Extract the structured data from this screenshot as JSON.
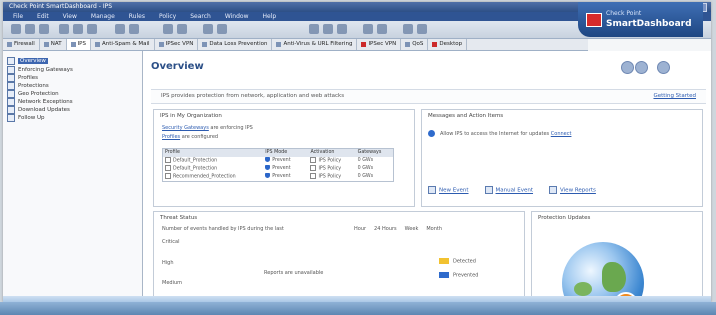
{
  "window": {
    "title": "Check Point SmartDashboard - IPS"
  },
  "menu": [
    "File",
    "Edit",
    "View",
    "Manage",
    "Rules",
    "Policy",
    "Search",
    "Window",
    "Help"
  ],
  "brand": {
    "line1": "Check Point",
    "line2": "SmartDashboard"
  },
  "tabs": [
    {
      "label": "Firewall",
      "icon": "firewall-icon"
    },
    {
      "label": "NAT",
      "icon": "nat-icon"
    },
    {
      "label": "IPS",
      "icon": "ips-icon"
    },
    {
      "label": "Anti-Spam & Mail",
      "icon": "mail-icon"
    },
    {
      "label": "IPSec VPN",
      "icon": "vpn-icon"
    },
    {
      "label": "Data Loss Prevention",
      "icon": "dlp-icon"
    },
    {
      "label": "Anti-Virus & URL Filtering",
      "icon": "antivirus-icon"
    },
    {
      "label": "IPSec VPN",
      "icon": "ipsec-icon"
    },
    {
      "label": "QoS",
      "icon": "qos-icon"
    },
    {
      "label": "Desktop",
      "icon": "desktop-icon"
    }
  ],
  "sidebar": [
    {
      "label": "Overview",
      "selected": true
    },
    {
      "label": "Enforcing Gateways",
      "selected": false
    },
    {
      "label": "Profiles",
      "selected": false
    },
    {
      "label": "Protections",
      "selected": false
    },
    {
      "label": "Geo Protection",
      "selected": false
    },
    {
      "label": "Network Exceptions",
      "selected": false
    },
    {
      "label": "Download Updates",
      "selected": false
    },
    {
      "label": "Follow Up",
      "selected": false
    }
  ],
  "page": {
    "title": "Overview",
    "description": "IPS provides protection from network, application and web attacks",
    "getting_started": "Getting Started"
  },
  "ips_panel": {
    "title": "IPS in My Organization",
    "line1_link": "Security Gateways",
    "line1_rest": "are enforcing IPS",
    "line2_link": "Profiles",
    "line2_rest": "are configured",
    "columns": [
      "Profile",
      "IPS Mode",
      "Activation",
      "Gateways"
    ],
    "rows": [
      {
        "profile": "Default_Protection",
        "mode": "Prevent",
        "activation": "IPS Policy",
        "gateways": "0 GWs"
      },
      {
        "profile": "Default_Protection",
        "mode": "Prevent",
        "activation": "IPS Policy",
        "gateways": "0 GWs"
      },
      {
        "profile": "Recommended_Protection",
        "mode": "Prevent",
        "activation": "IPS Policy",
        "gateways": "0 GWs"
      }
    ]
  },
  "messages_panel": {
    "title": "Messages and Action Items",
    "message": "Allow IPS to access the Internet for updates",
    "message_link": "Connect",
    "actions": [
      "New Event",
      "Manual Event",
      "View Reports"
    ]
  },
  "threat_panel": {
    "title": "Threat Status",
    "subtitle": "Number of events handled by IPS during the last",
    "filters": [
      "Hour",
      "24 Hours",
      "Week",
      "Month"
    ],
    "severities": [
      "Critical",
      "High",
      "Medium"
    ],
    "empty_text": "Reports are unavailable",
    "legend": [
      {
        "label": "Detected",
        "color": "#f2c230"
      },
      {
        "label": "Prevented",
        "color": "#2f6bcc"
      }
    ]
  },
  "update_panel": {
    "title": "Protection Updates"
  }
}
